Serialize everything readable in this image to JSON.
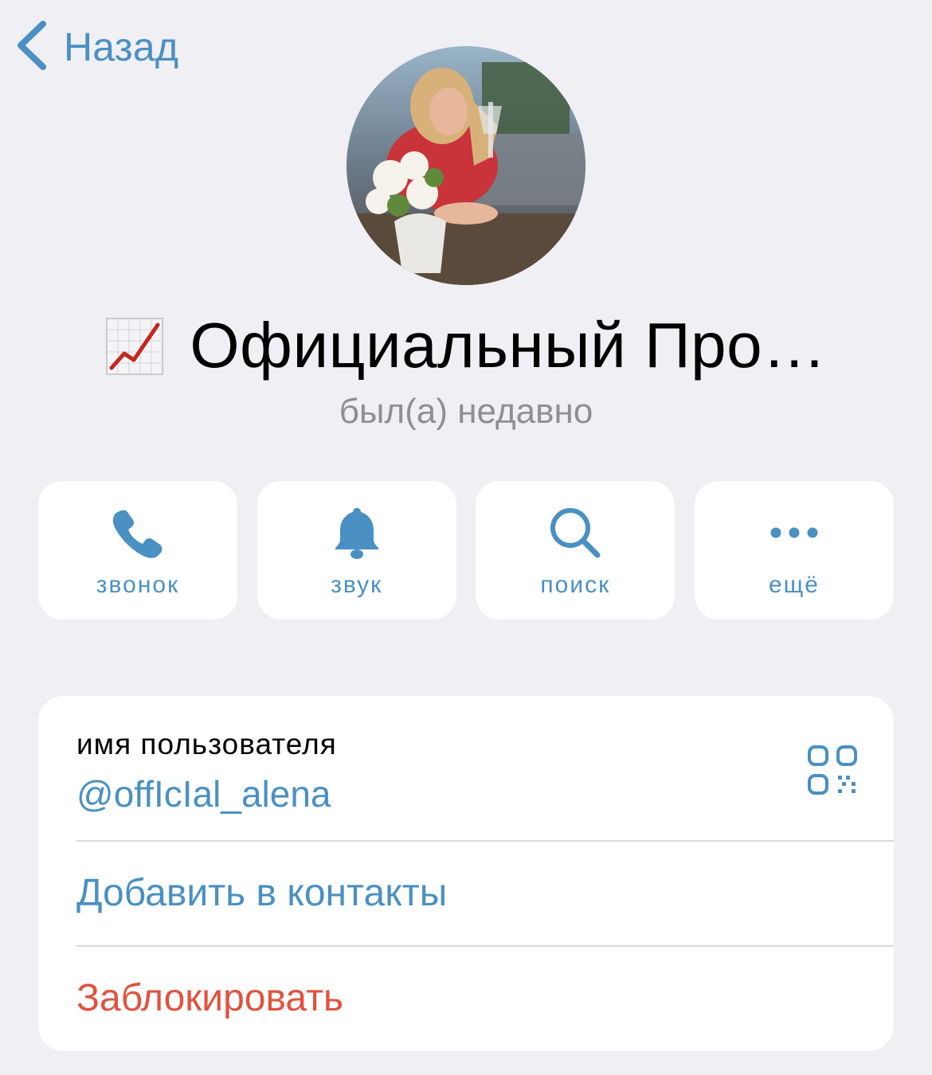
{
  "nav": {
    "back_label": "Назад",
    "back_icon": "chevron-left-icon"
  },
  "profile": {
    "name": "Официальный Про…",
    "name_emoji": "chart-increasing-emoji",
    "status": "был(а) недавно"
  },
  "actions": [
    {
      "label": "звонок",
      "icon": "phone-icon"
    },
    {
      "label": "звук",
      "icon": "bell-icon"
    },
    {
      "label": "поиск",
      "icon": "search-icon"
    },
    {
      "label": "ещё",
      "icon": "more-icon"
    }
  ],
  "info": {
    "username_caption": "имя пользователя",
    "username": "@offIcIal_alena",
    "qr_icon": "qr-code-icon",
    "add_contact": "Добавить в контакты",
    "block": "Заблокировать"
  },
  "colors": {
    "accent": "#4a90c2",
    "destructive": "#e0533e",
    "background": "#efeff4",
    "secondary_text": "#8e8e93"
  }
}
